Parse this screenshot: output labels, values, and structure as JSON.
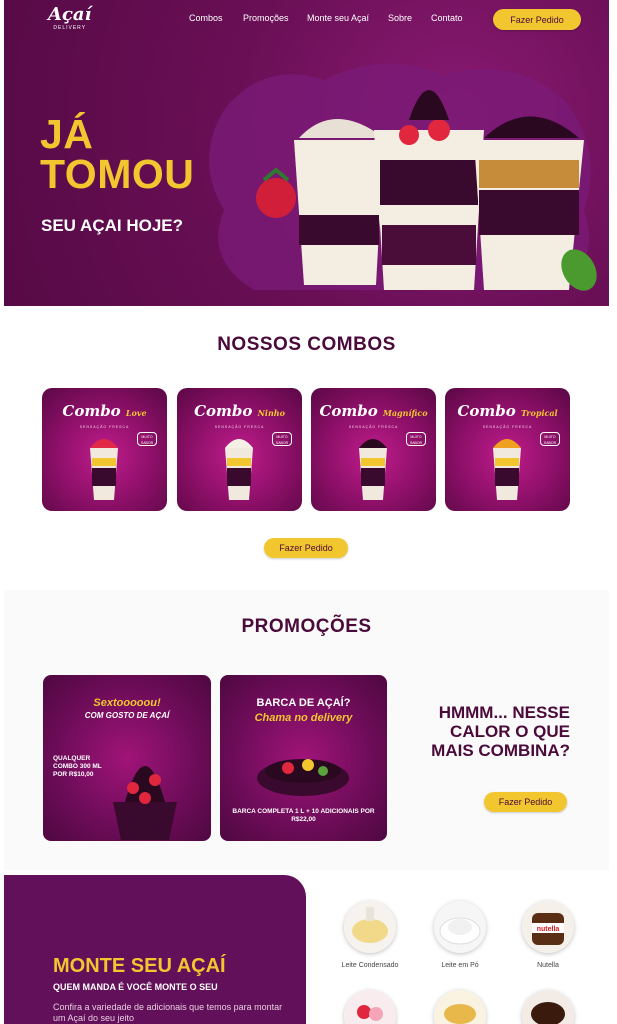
{
  "nav": {
    "logo_text": "Açaí",
    "logo_sub": "DELIVERY",
    "links": [
      "Combos",
      "Promoções",
      "Monte seu Açaí",
      "Sobre",
      "Contato"
    ],
    "order_button": "Fazer Pedido"
  },
  "hero": {
    "title_line1": "JÁ",
    "title_line2": "TOMOU",
    "subtitle": "SEU AÇAI HOJE?"
  },
  "combos": {
    "title": "NOSSOS COMBOS",
    "tagline": "SENSAÇÃO FRESCA",
    "bubble": "MUITO SABOR",
    "cards": [
      {
        "word": "Combo",
        "accent": "Love"
      },
      {
        "word": "Combo",
        "accent": "Ninho"
      },
      {
        "word": "Combo",
        "accent": "Magnífico"
      },
      {
        "word": "Combo",
        "accent": "Tropical"
      }
    ],
    "order_button": "Fazer Pedido"
  },
  "promos": {
    "title": "PROMOÇÕES",
    "card1": {
      "heading1": "Sextooooou!",
      "heading2": "COM GOSTO DE AÇAÍ",
      "text": "QUALQUER COMBO 300 ML POR R$10,00"
    },
    "card2": {
      "heading1": "BARCA DE AÇAÍ?",
      "heading2": "Chama no delivery",
      "text": "BARCA COMPLETA 1 L + 10 ADICIONAIS POR R$22,00"
    },
    "cta": "HMMM... NESSE CALOR O QUE MAIS COMBINA?",
    "order_button": "Fazer Pedido"
  },
  "monte": {
    "title": "MONTE SEU AÇAÍ",
    "subtitle": "QUEM MANDA É VOCÊ MONTE O SEU",
    "description": "Confira a variedade de adicionais que temos para montar um Açaí do seu jeito",
    "toppings": [
      "Leite Condensado",
      "Leite em Pó",
      "Nutella"
    ]
  },
  "colors": {
    "brand_purple": "#6a0f56",
    "brand_yellow": "#f2c62f",
    "dark_text": "#4a0a3a"
  }
}
